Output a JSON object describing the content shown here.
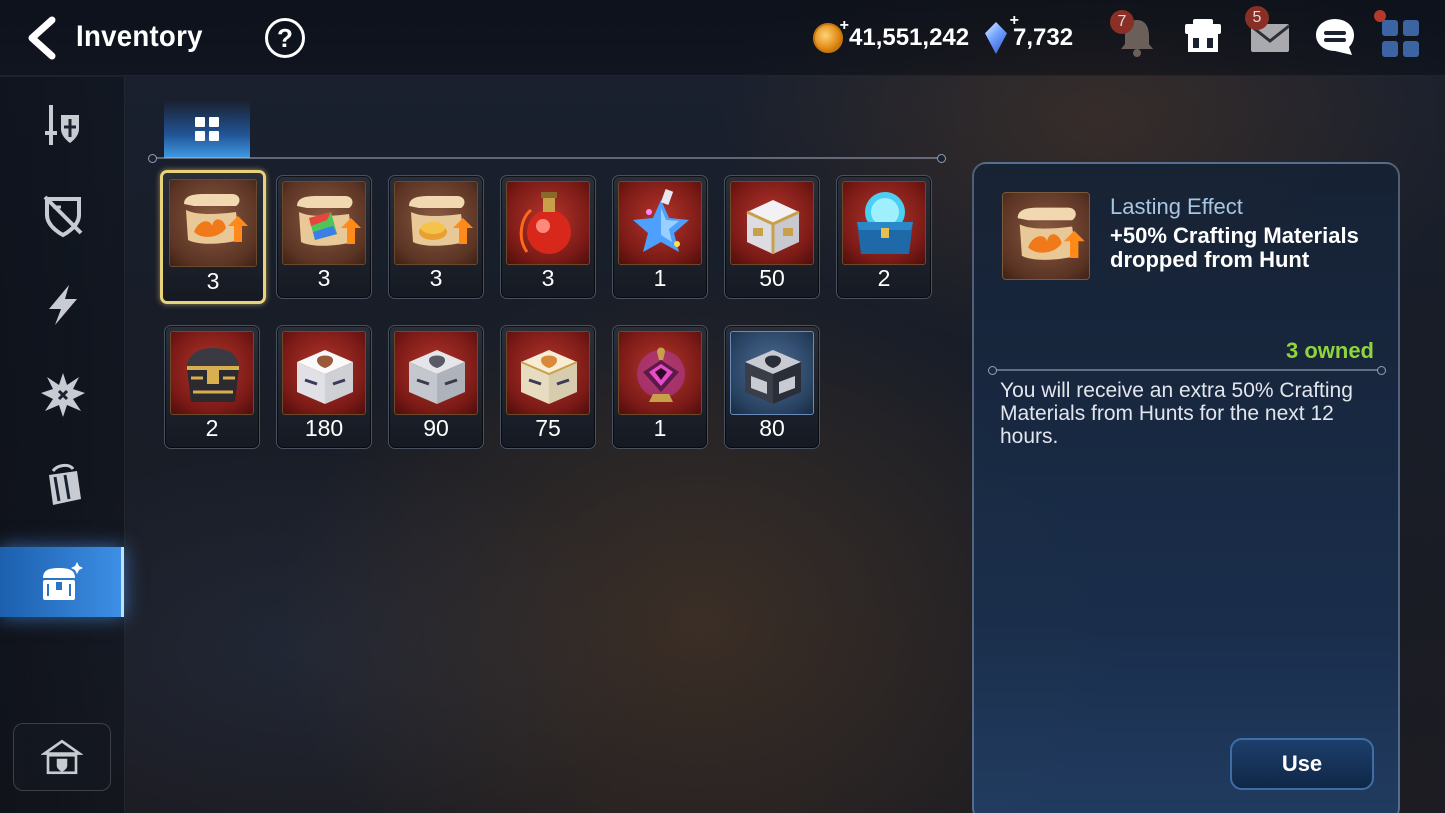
{
  "header": {
    "title": "Inventory",
    "help_label": "?",
    "gold_amount": "41,551,242",
    "crystal_amount": "7,732",
    "notifications_badge": "7",
    "mail_badge": "5"
  },
  "icons": {
    "back": "back-arrow-icon",
    "help": "help-icon",
    "gold": "gold-coin-icon",
    "crystal": "crystal-icon",
    "notifications": "bell-icon",
    "shop": "shop-icon",
    "mail": "mail-icon",
    "chat": "chat-icon",
    "menu": "grid-menu-icon"
  },
  "sidebar": {
    "items": [
      {
        "name": "equipment-tab",
        "icon": "sword-shield-icon",
        "active": false
      },
      {
        "name": "artifacts-tab",
        "icon": "broken-shield-icon",
        "active": false
      },
      {
        "name": "consumables-tab",
        "icon": "lightning-icon",
        "active": false
      },
      {
        "name": "catalysts-tab",
        "icon": "burst-icon",
        "active": false
      },
      {
        "name": "materials-tab",
        "icon": "bag-icon",
        "active": false
      },
      {
        "name": "items-tab",
        "icon": "chest-icon",
        "active": true
      }
    ],
    "home_icon": "guild-home-icon"
  },
  "tabs": [
    {
      "icon": "grid-icon",
      "active": true
    }
  ],
  "items": [
    {
      "icon": "scroll-fire-boost-icon",
      "qty": "3",
      "frame": "brown",
      "selected": true
    },
    {
      "icon": "scroll-rainbow-boost-icon",
      "qty": "3",
      "frame": "brown"
    },
    {
      "icon": "scroll-gold-boost-icon",
      "qty": "3",
      "frame": "brown"
    },
    {
      "icon": "red-potion-icon",
      "qty": "3",
      "frame": "red"
    },
    {
      "icon": "star-potion-icon",
      "qty": "1",
      "frame": "red"
    },
    {
      "icon": "white-gold-chest-icon",
      "qty": "50",
      "frame": "red"
    },
    {
      "icon": "blue-crystal-chest-icon",
      "qty": "2",
      "frame": "red"
    },
    {
      "icon": "dark-gold-chest-icon",
      "qty": "2",
      "frame": "red"
    },
    {
      "icon": "white-box-icon",
      "qty": "180",
      "frame": "red"
    },
    {
      "icon": "silver-box-icon",
      "qty": "90",
      "frame": "red"
    },
    {
      "icon": "cream-box-icon",
      "qty": "75",
      "frame": "red"
    },
    {
      "icon": "magic-lamp-icon",
      "qty": "1",
      "frame": "red"
    },
    {
      "icon": "dark-silver-box-icon",
      "qty": "80",
      "frame": "blue"
    }
  ],
  "detail": {
    "type": "Lasting Effect",
    "name": "+50% Crafting Materials dropped from Hunt",
    "owned": "3 owned",
    "description": "You will receive an extra 50% Crafting Materials from Hunts for the next 12 hours.",
    "use_label": "Use",
    "icon": "scroll-fire-boost-icon"
  },
  "colors": {
    "accent": "#3d8fe5",
    "owned": "#8fd43c",
    "selected_border": "#e8d27a"
  }
}
